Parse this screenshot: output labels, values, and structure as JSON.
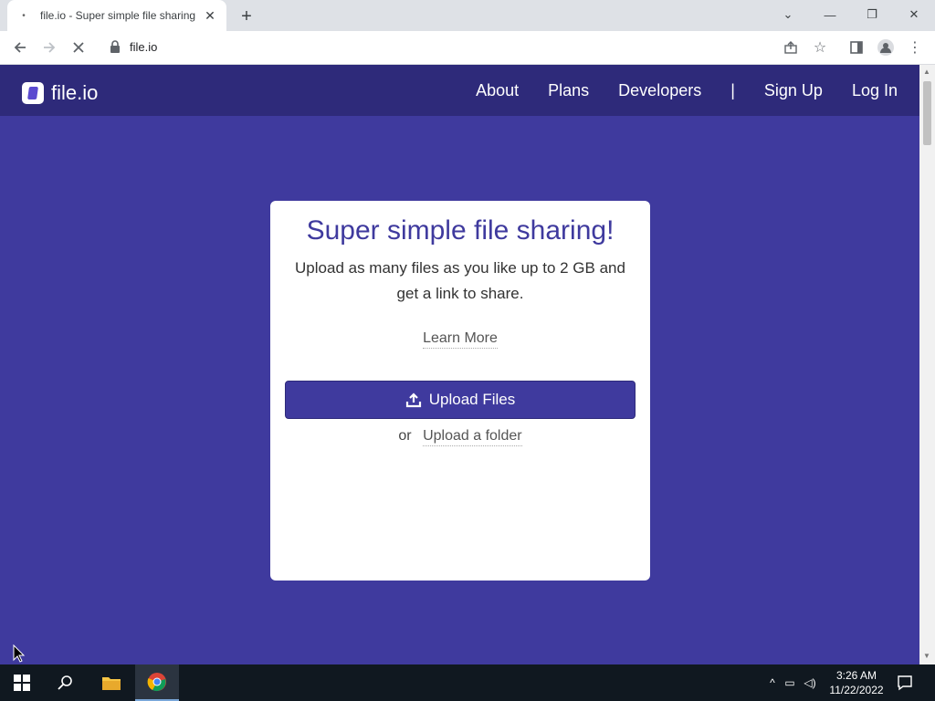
{
  "browser": {
    "tab_title": "file.io - Super simple file sharing",
    "url": "file.io"
  },
  "site": {
    "logo_text": "file.io",
    "nav": [
      "About",
      "Plans",
      "Developers",
      "|",
      "Sign Up",
      "Log In"
    ]
  },
  "card": {
    "heading": "Super simple file sharing!",
    "description": "Upload as many files as you like up to 2 GB and get a link to share.",
    "learn_more": "Learn More",
    "upload_button": "Upload Files",
    "or_text": "or",
    "upload_folder": "Upload a folder"
  },
  "taskbar": {
    "time": "3:26 AM",
    "date": "11/22/2022"
  },
  "colors": {
    "brand": "#3f3a9e",
    "navbar": "#2e2a7a"
  }
}
